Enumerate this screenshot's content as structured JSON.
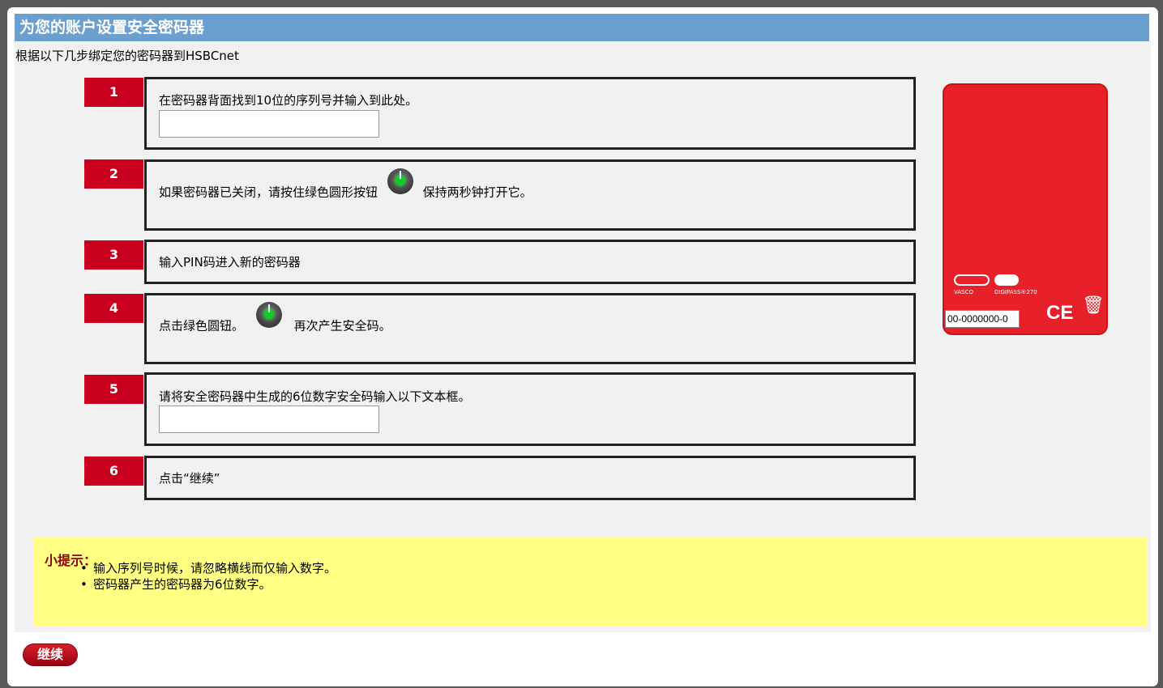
{
  "header": {
    "title": "为您的账户设置安全密码器",
    "subtitle": "根据以下几步绑定您的密码器到HSBCnet"
  },
  "steps": [
    {
      "number": "1",
      "text": "在密码器背面找到10位的序列号并输入到此处。",
      "input_value": ""
    },
    {
      "number": "2",
      "text_before": "如果密码器已关闭，请按住绿色圆形按钮",
      "text_after": "保持两秒钟打开它。"
    },
    {
      "number": "3",
      "text": "输入PIN码进入新的密码器"
    },
    {
      "number": "4",
      "text_before": "点击绿色圆钮。",
      "text_after": "再次产生安全码。"
    },
    {
      "number": "5",
      "text": "请将安全密码器中生成的6位数字安全码输入以下文本框。",
      "input_value": ""
    },
    {
      "number": "6",
      "text": "点击“继续”"
    }
  ],
  "device": {
    "serial": "00-0000000-0",
    "brand": "VASCO",
    "model": "DIGIPASS®270",
    "mark": "CE",
    "color": "#e8202a"
  },
  "tip": {
    "title": "小提示：",
    "items": [
      "输入序列号时候，请忽略横线而仅输入数字。",
      "密码器产生的密码器为6位数字。"
    ]
  },
  "actions": {
    "continue_label": "继续"
  }
}
